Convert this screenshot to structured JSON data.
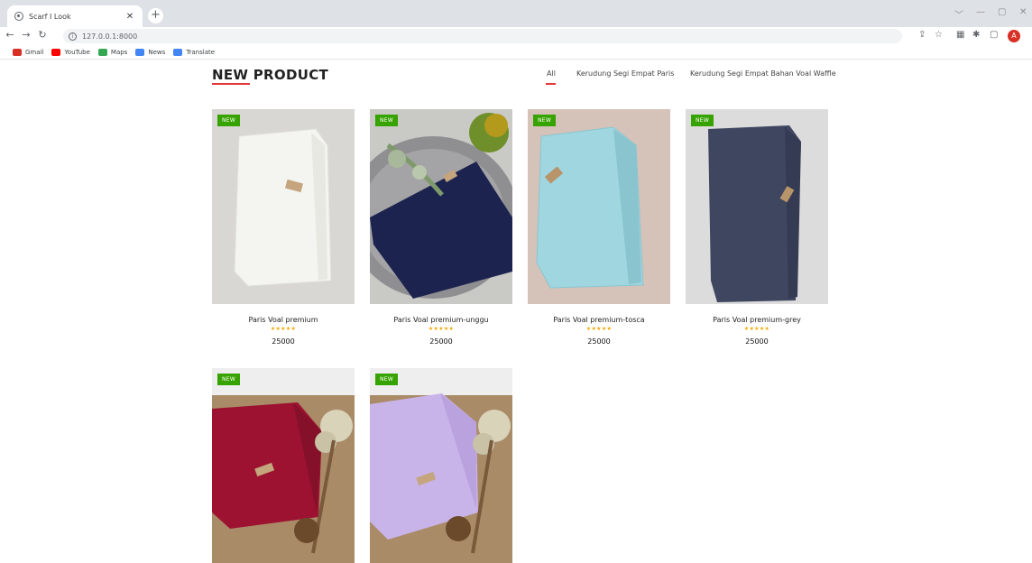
{
  "browser": {
    "tab_title": "Scarf I Look",
    "tab_close": "✕",
    "new_tab": "+",
    "url": "127.0.0.1:8000",
    "profile_initial": "A",
    "window_controls": [
      "﹀",
      "—",
      "▢",
      "✕"
    ],
    "bookmarks": [
      {
        "label": "Gmail",
        "color": "#d93025"
      },
      {
        "label": "YouTube",
        "color": "#ff0000"
      },
      {
        "label": "Maps",
        "color": "#34a853"
      },
      {
        "label": "News",
        "color": "#4285f4"
      },
      {
        "label": "Translate",
        "color": "#4285f4"
      }
    ]
  },
  "section": {
    "title": "NEW PRODUCT",
    "filters": [
      "All",
      "Kerudung Segi Empat Paris",
      "Kerudung Segi Empat Bahan Voal Waffle"
    ],
    "active_filter": "All",
    "accent_color": "#e53637"
  },
  "products": [
    {
      "badge": "NEW",
      "name": "Paris Voal premium",
      "rating": "★★★★★",
      "price": "25000",
      "color": "#f2f2ee",
      "bg": "#d8d6d3"
    },
    {
      "badge": "NEW",
      "name": "Paris Voal premium-unggu",
      "rating": "★★★★★",
      "price": "25000",
      "color": "#1b2350",
      "bg": "#cfcfcf"
    },
    {
      "badge": "NEW",
      "name": "Paris Voal premium-tosca",
      "rating": "★★★★★",
      "price": "25000",
      "color": "#9fd8e2",
      "bg": "#d9c7bd"
    },
    {
      "badge": "NEW",
      "name": "Paris Voal premium-grey",
      "rating": "★★★★★",
      "price": "25000",
      "color": "#3f4660",
      "bg": "#dcdcdc"
    },
    {
      "badge": "NEW",
      "name": "",
      "rating": "",
      "price": "",
      "color": "#9e1230",
      "bg": "#a88c6a"
    },
    {
      "badge": "NEW",
      "name": "",
      "rating": "",
      "price": "",
      "color": "#c7b3e8",
      "bg": "#a88c6a"
    }
  ]
}
